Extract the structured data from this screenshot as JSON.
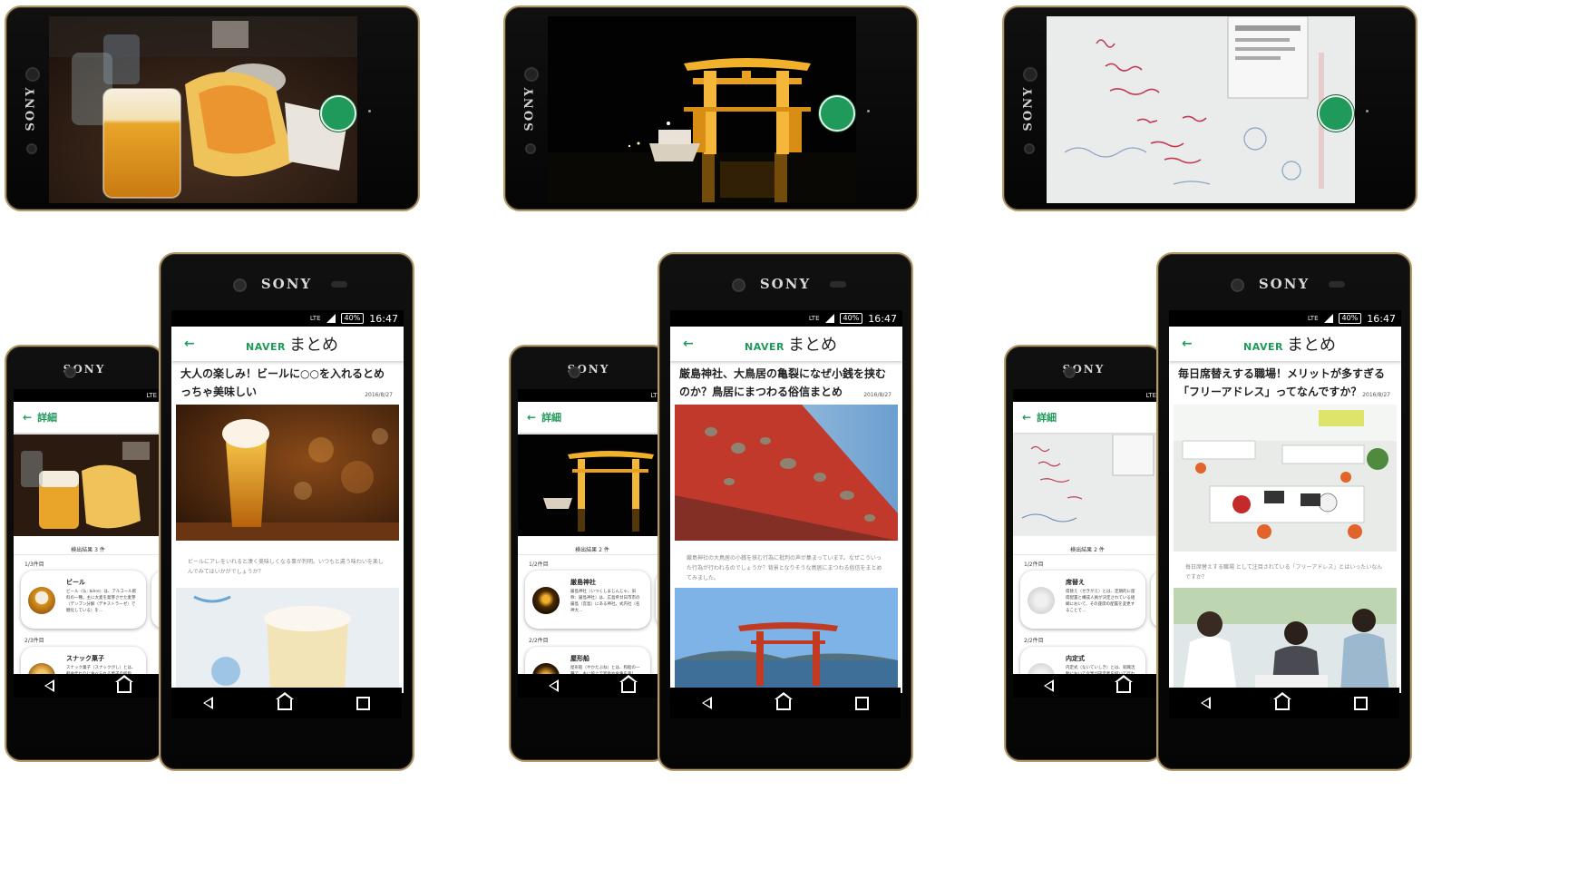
{
  "device": {
    "brand": "SONY"
  },
  "status": {
    "network": "LTE",
    "battery": "40%",
    "time": "16:47"
  },
  "app": {
    "logo_naver": "NAVER",
    "logo_matome": "まとめ",
    "detail_title": "詳細"
  },
  "search": {
    "result_label": "検出結果",
    "beer": {
      "count": "3 件",
      "first_index": "1/3件目",
      "second_index": "2/3件目"
    },
    "torii": {
      "count": "2 件",
      "first_index": "1/2件目",
      "second_index": "2/2件目"
    },
    "office": {
      "count": "2 件",
      "first_index": "1/2件目",
      "second_index": "2/2件目"
    }
  },
  "cards": {
    "beer": [
      {
        "title": "ビール",
        "text": "ビール（仏: bière）は、アルコール飲料の一種。主に大麦を発芽させた麦芽（デンプン分解（デキストラーゼ）で糖化している）を…"
      },
      {
        "title": "スナック菓子",
        "text": "スナック菓子（スナックがし）とは、軽食代わりに食べられる菓子の総称で、そのほとんどは、とうもろこしなどの…"
      }
    ],
    "torii": [
      {
        "title": "厳島神社",
        "text": "厳島神社（いつくしまじんじゃ、旧称：厳島神社）は、広島県廿日市市の厳島（宮島）にある神社。式内社（名神大…"
      },
      {
        "title": "屋形船",
        "text": "屋形船（やかたぶね）とは、和船の一種で、主に船上で宴会や食事を楽しむ、屋根と座敷を設けた船のこと。"
      }
    ],
    "office": [
      {
        "title": "席替え",
        "text": "席替え（せきがえ）とは、定期的に座席配置と構成人員が決定されている組織において、その座席の配置を変更することで…"
      },
      {
        "title": "内定式",
        "text": "内定式（ないていしき）とは、就職活動において企業が内定者を招いて行われている式典…"
      }
    ]
  },
  "articles": {
    "beer": {
      "title": "大人の楽しみ！ビールに○○を入れるとめっちゃ美味しい",
      "date": "2016/8/27",
      "caption": "ビールにアレをいれると凄く美味しくなる事が判明。いつもと違う味わいを楽しんでみてはいかがでしょうか？"
    },
    "torii": {
      "title": "厳島神社、大鳥居の亀裂になぜ小銭を挟むのか？鳥居にまつわる俗信まとめ",
      "date": "2016/8/27",
      "caption": "厳島神社の大鳥居の小銭を挟む行為に批判の声が集まっています。なぜこういった行為が行われるのでしょうか？背景となりそうな鳥居にまつわる俗信をまとめてみました。"
    },
    "office": {
      "title": "毎日席替えする職場！メリットが多すぎる「フリーアドレス」ってなんですか？",
      "date": "2016/8/27",
      "caption": "毎日席替えする職場 として注目されている「フリーアドレス」とはいったいなんですか？"
    }
  },
  "colors": {
    "accent": "#1f9a5a",
    "frame": "#b39a6c"
  }
}
